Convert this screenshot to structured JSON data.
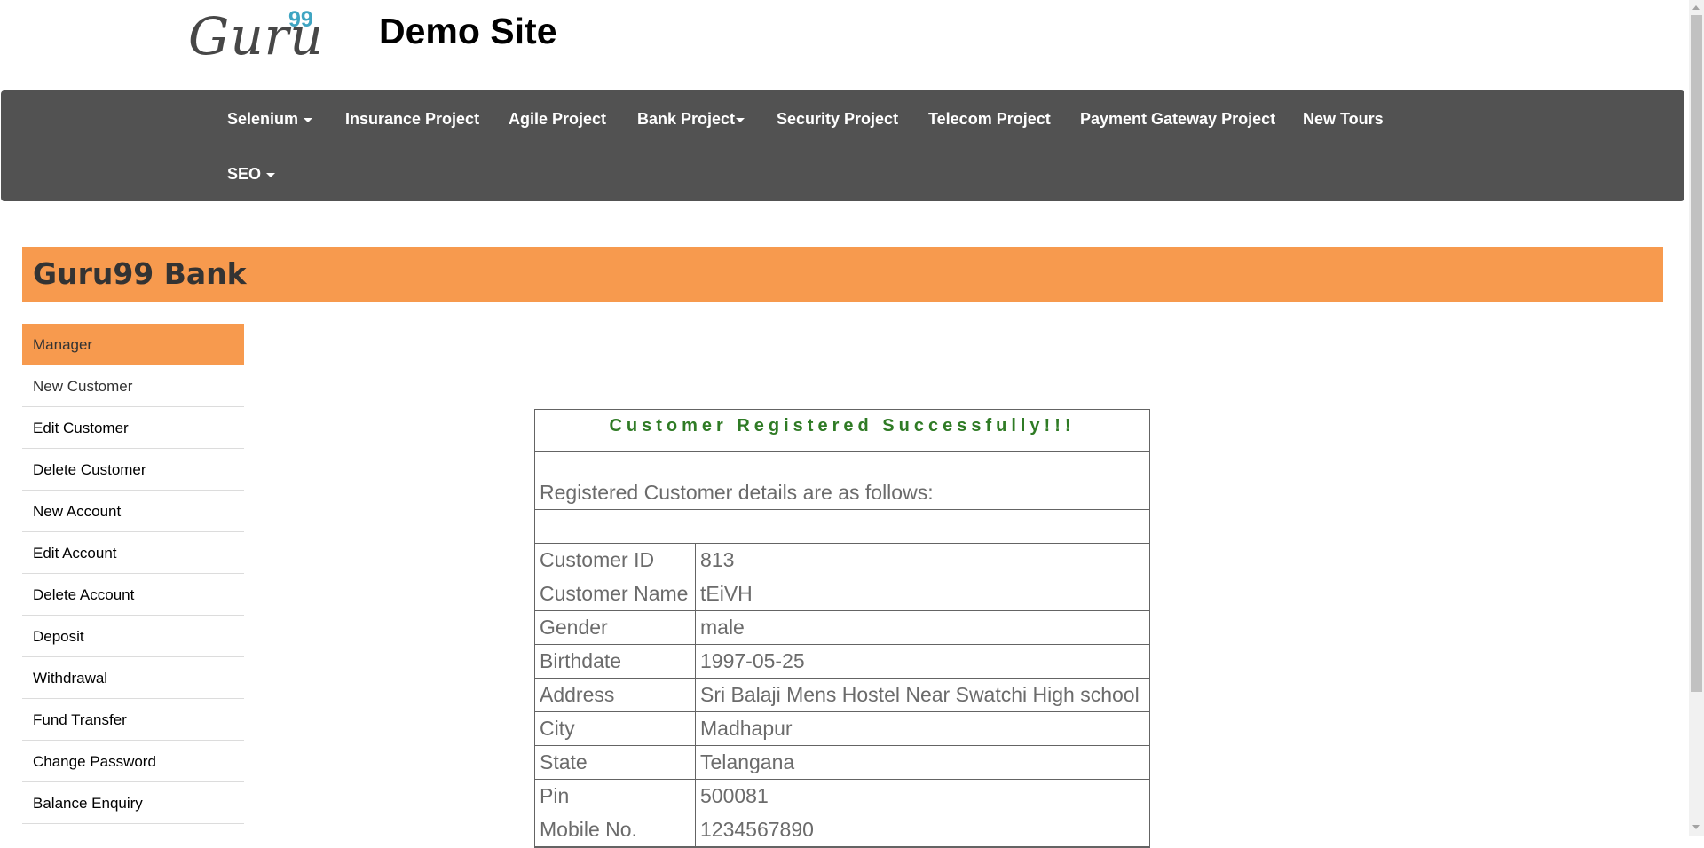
{
  "header": {
    "logo_text": "Guru",
    "logo_number": "99",
    "site_title": "Demo Site"
  },
  "nav": {
    "items": [
      {
        "label": "Selenium",
        "dropdown": true
      },
      {
        "label": "Insurance Project",
        "dropdown": false
      },
      {
        "label": "Agile Project",
        "dropdown": false
      },
      {
        "label": "Bank Project",
        "dropdown": true
      },
      {
        "label": "Security Project",
        "dropdown": false
      },
      {
        "label": "Telecom Project",
        "dropdown": false
      },
      {
        "label": "Payment Gateway Project",
        "dropdown": false
      },
      {
        "label": "New Tours",
        "dropdown": false
      },
      {
        "label": "SEO",
        "dropdown": true
      }
    ]
  },
  "banner": {
    "title": "Guru99 Bank"
  },
  "menu": {
    "header": "Manager",
    "items": [
      "New Customer",
      "Edit Customer",
      "Delete Customer",
      "New Account",
      "Edit Account",
      "Delete Account",
      "Deposit",
      "Withdrawal",
      "Fund Transfer",
      "Change Password",
      "Balance Enquiry"
    ]
  },
  "result": {
    "heading": "Customer Registered Successfully!!!",
    "intro": "Registered Customer details are as follows:",
    "rows": [
      {
        "label": "Customer ID",
        "value": "813"
      },
      {
        "label": "Customer Name",
        "value": "tEiVH"
      },
      {
        "label": "Gender",
        "value": "male"
      },
      {
        "label": "Birthdate",
        "value": "1997-05-25"
      },
      {
        "label": "Address",
        "value": "Sri Balaji Mens Hostel Near Swatchi High school"
      },
      {
        "label": "City",
        "value": "Madhapur"
      },
      {
        "label": "State",
        "value": "Telangana"
      },
      {
        "label": "Pin",
        "value": "500081"
      },
      {
        "label": "Mobile No.",
        "value": "1234567890"
      }
    ]
  },
  "colors": {
    "navbar": "#525252",
    "accent_orange": "#f79a4e",
    "success_green": "#2f7b25",
    "logo_blue": "#3fa5c2"
  }
}
